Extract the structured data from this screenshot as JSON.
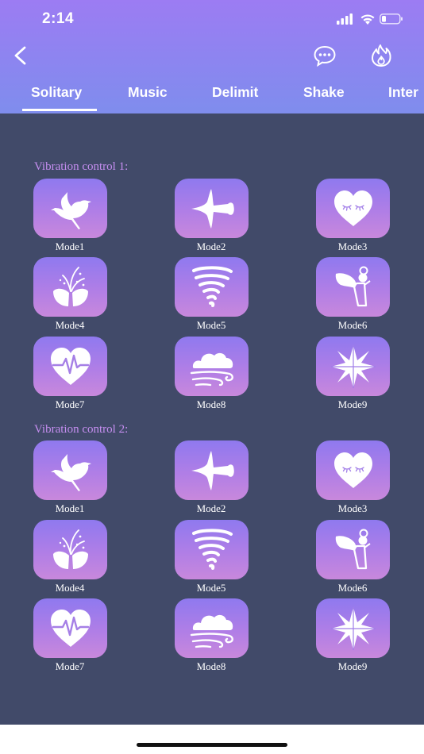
{
  "status_bar": {
    "time": "2:14"
  },
  "tabs": [
    {
      "label": "Solitary",
      "active": true
    },
    {
      "label": "Music",
      "active": false
    },
    {
      "label": "Delimit",
      "active": false
    },
    {
      "label": "Shake",
      "active": false
    },
    {
      "label": "Inter",
      "active": false
    }
  ],
  "sections": [
    {
      "title": "Vibration control 1:",
      "modes": [
        {
          "label": "Mode1",
          "icon": "bird-icon"
        },
        {
          "label": "Mode2",
          "icon": "plane-icon"
        },
        {
          "label": "Mode3",
          "icon": "heart-icon"
        },
        {
          "label": "Mode4",
          "icon": "fountain-icon"
        },
        {
          "label": "Mode5",
          "icon": "tornado-icon"
        },
        {
          "label": "Mode6",
          "icon": "angel-icon"
        },
        {
          "label": "Mode7",
          "icon": "heartbeat-icon"
        },
        {
          "label": "Mode8",
          "icon": "wind-cloud-icon"
        },
        {
          "label": "Mode9",
          "icon": "star-icon"
        }
      ]
    },
    {
      "title": "Vibration control 2:",
      "modes": [
        {
          "label": "Mode1",
          "icon": "bird-icon"
        },
        {
          "label": "Mode2",
          "icon": "plane-icon"
        },
        {
          "label": "Mode3",
          "icon": "heart-icon"
        },
        {
          "label": "Mode4",
          "icon": "fountain-icon"
        },
        {
          "label": "Mode5",
          "icon": "tornado-icon"
        },
        {
          "label": "Mode6",
          "icon": "angel-icon"
        },
        {
          "label": "Mode7",
          "icon": "heartbeat-icon"
        },
        {
          "label": "Mode8",
          "icon": "wind-cloud-icon"
        },
        {
          "label": "Mode9",
          "icon": "star-icon"
        }
      ]
    }
  ],
  "colors": {
    "header_top": "#9c7cf3",
    "header_bottom": "#7f8ded",
    "background": "#414a69",
    "section_title": "#c58ef0",
    "tile_top": "#8f79ef",
    "tile_bottom": "#c888dc"
  }
}
